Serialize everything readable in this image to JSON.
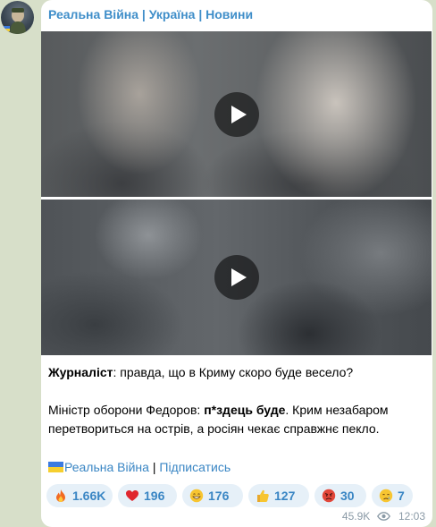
{
  "channel": {
    "name": "Реальна Війна | Україна | Новини"
  },
  "videos": [
    {
      "play_icon": "play-icon"
    },
    {
      "play_icon": "play-icon"
    }
  ],
  "message": {
    "line1_label": "Журналіст",
    "line1_rest": ": правда, що в Криму скоро буде весело?",
    "line2_prefix": "Міністр оборони Федоров: ",
    "line2_bold": "п*здець буде",
    "line2_suffix": ". Крим незабаром перетвориться на острів, а росіян чекає справжнє пекло."
  },
  "footer": {
    "channel_link": "Реальна Війна",
    "separator": " | ",
    "subscribe_link": "Підписатись"
  },
  "reactions": [
    {
      "emoji": "fire",
      "count": "1.66K"
    },
    {
      "emoji": "red-heart",
      "count": "196"
    },
    {
      "emoji": "grinning-face",
      "count": "176"
    },
    {
      "emoji": "thumbs-up",
      "count": "127"
    },
    {
      "emoji": "angry-face",
      "count": "30"
    },
    {
      "emoji": "crying-face",
      "count": "7"
    }
  ],
  "meta": {
    "views": "45.9K",
    "time": "12:03"
  },
  "colors": {
    "link": "#3a86c4",
    "channel_name": "#3f8ec9",
    "reaction_bg": "#e6f0f8",
    "chat_bg": "#d7dfc9"
  }
}
